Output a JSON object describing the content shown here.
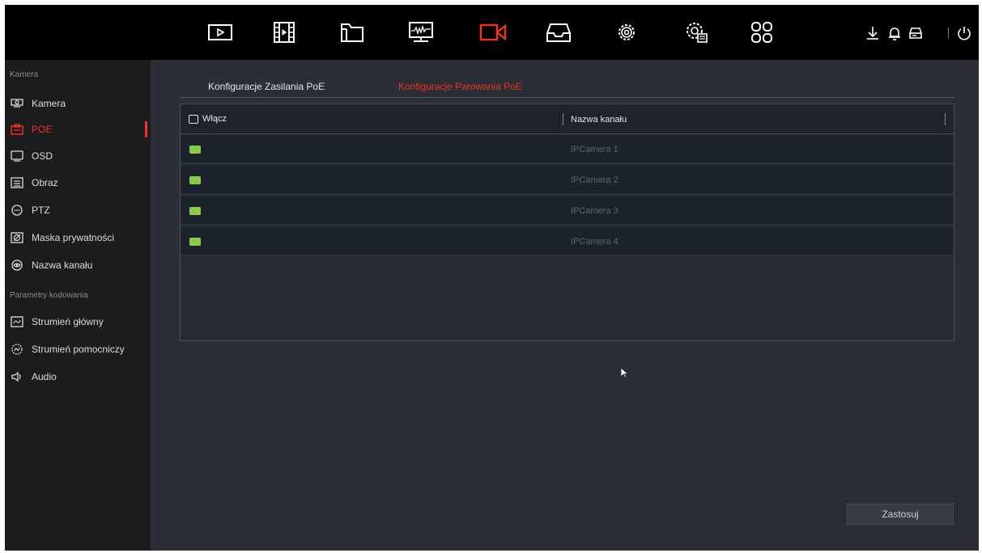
{
  "topnav": {
    "items": [
      {
        "name": "playback-icon",
        "active": false
      },
      {
        "name": "video-clip-icon",
        "active": false
      },
      {
        "name": "file-folder-icon",
        "active": false
      },
      {
        "name": "monitor-icon",
        "active": false
      },
      {
        "name": "camera-icon",
        "active": true
      },
      {
        "name": "storage-icon",
        "active": false
      },
      {
        "name": "settings-icon",
        "active": false
      },
      {
        "name": "advanced-settings-icon",
        "active": false
      },
      {
        "name": "apps-grid-icon",
        "active": false
      }
    ],
    "right_icons": [
      "download-icon",
      "bell-icon",
      "hdd-icon",
      "power-icon"
    ]
  },
  "sidebar": {
    "section1": "Kamera",
    "items1": [
      {
        "label": "Kamera",
        "icon": "camera-list-icon"
      },
      {
        "label": "POE",
        "icon": "poe-icon",
        "active": true
      },
      {
        "label": "OSD",
        "icon": "osd-icon"
      },
      {
        "label": "Obraz",
        "icon": "image-icon"
      },
      {
        "label": "PTZ",
        "icon": "ptz-icon"
      },
      {
        "label": "Maska prywatności",
        "icon": "privacy-mask-icon"
      },
      {
        "label": "Nazwa kanału",
        "icon": "channel-name-icon"
      }
    ],
    "section2": "Parametry kodowania",
    "items2": [
      {
        "label": "Strumień główny",
        "icon": "main-stream-icon"
      },
      {
        "label": "Strumień pomocniczy",
        "icon": "sub-stream-icon"
      },
      {
        "label": "Audio",
        "icon": "audio-icon"
      }
    ]
  },
  "tabs": [
    {
      "label": "Konfiguracje Zasilania PoE",
      "active": false
    },
    {
      "label": "Konfiguracje Parowania PoE",
      "active": true
    }
  ],
  "table": {
    "columns": [
      "Włącz",
      "Nazwa kanału"
    ],
    "rows": [
      {
        "enabled": true,
        "name": "IPCamera 1"
      },
      {
        "enabled": true,
        "name": "IPCamera 2"
      },
      {
        "enabled": true,
        "name": "IPCamera 3"
      },
      {
        "enabled": true,
        "name": "IPCamera 4"
      }
    ]
  },
  "apply_label": "Zastosuj",
  "colors": {
    "accent": "#f0331a",
    "led": "#8cc94c",
    "topbar": "#000000",
    "sidebar": "#1c1c1f",
    "content": "#2b2e36"
  }
}
